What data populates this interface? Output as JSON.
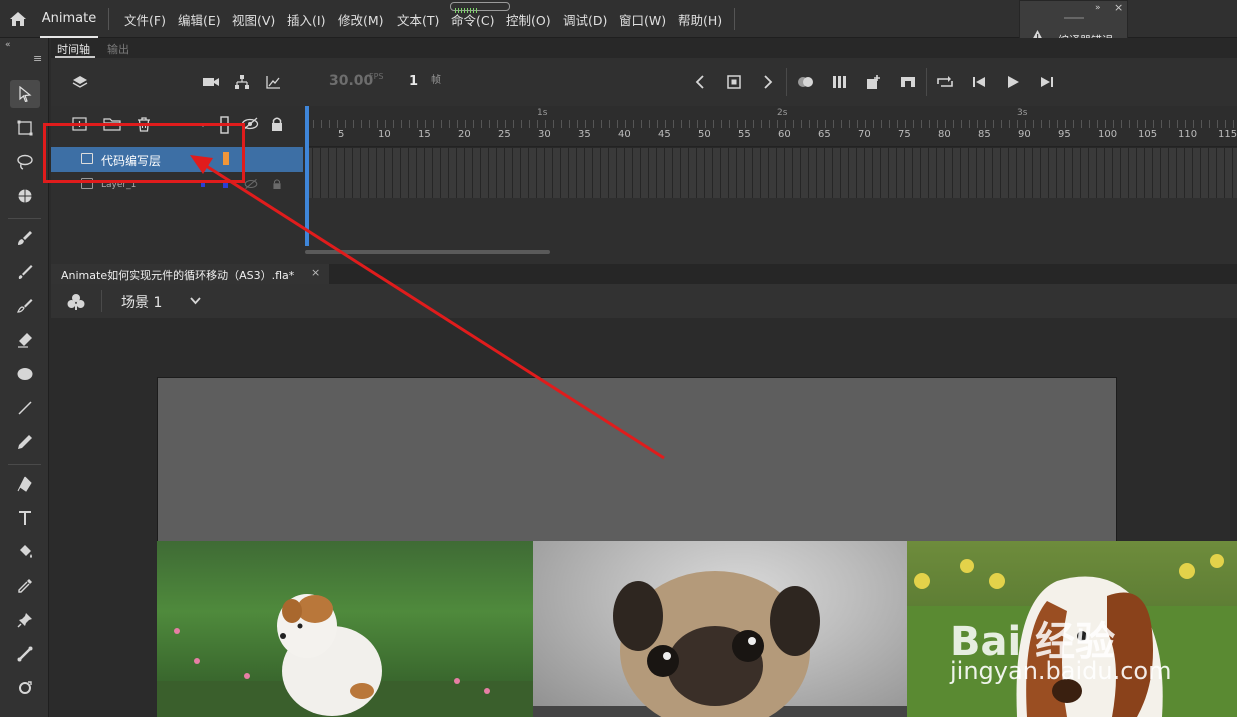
{
  "app": {
    "name": "Animate"
  },
  "menu": [
    "文件(F)",
    "编辑(E)",
    "视图(V)",
    "插入(I)",
    "修改(M)",
    "文本(T)",
    "命令(C)",
    "控制(O)",
    "调试(D)",
    "窗口(W)",
    "帮助(H)"
  ],
  "compile_panel": {
    "label": "编译器错误"
  },
  "panel_tabs": {
    "timeline": "时间轴",
    "output": "输出"
  },
  "timeline": {
    "fps": "30.00",
    "fps_unit": "FPS",
    "current_frame": "1",
    "frame_unit": "帧",
    "seconds": [
      "1s",
      "2s",
      "3s"
    ],
    "ticks": [
      "5",
      "10",
      "15",
      "20",
      "25",
      "30",
      "35",
      "40",
      "45",
      "50",
      "55",
      "60",
      "65",
      "70",
      "75",
      "80",
      "85",
      "90",
      "95",
      "100",
      "105",
      "110",
      "115"
    ]
  },
  "layers": [
    {
      "name": "代码编写层",
      "selected": true,
      "color": "#f0963a"
    },
    {
      "name": "Layer_1",
      "selected": false,
      "color": "#2a3fd6"
    }
  ],
  "document": {
    "title": "Animate如何实现元件的循环移动（AS3）.fla*",
    "close": "×"
  },
  "scene": {
    "label": "场景 1"
  },
  "watermark": {
    "brand": "Bai 经验",
    "url": "jingyan.baidu.com"
  },
  "colors": {
    "selection": "#3d6fa5",
    "annotation": "#e01c1c",
    "playhead": "#3f86d9"
  }
}
